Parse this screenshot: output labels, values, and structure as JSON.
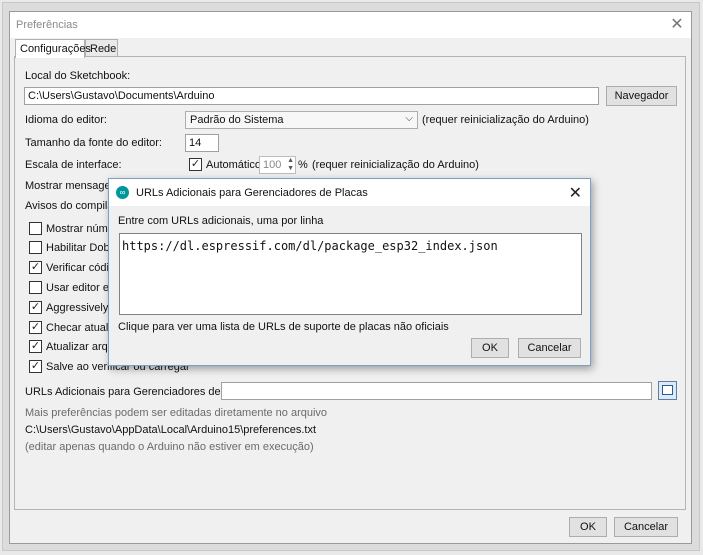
{
  "window": {
    "title": "Preferências",
    "close_glyph": "✕"
  },
  "tabs": [
    {
      "label": "Configurações"
    },
    {
      "label": "Rede"
    }
  ],
  "sketchbook": {
    "label": "Local do Sketchbook:",
    "path": "C:\\Users\\Gustavo\\Documents\\Arduino",
    "browse_button": "Navegador"
  },
  "language": {
    "label": "Idioma do editor:",
    "selected": "Padrão do Sistema",
    "note": "(requer reinicialização do Arduino)"
  },
  "font_size": {
    "label": "Tamanho da fonte do editor:",
    "value": "14"
  },
  "scale": {
    "label": "Escala de interface:",
    "auto_label": "Automático",
    "value": "100",
    "unit": "%",
    "note": "(requer reinicialização do Arduino)"
  },
  "show_messages": {
    "label": "Mostrar mensagens"
  },
  "compiler_warnings": {
    "label": "Avisos do compilador"
  },
  "checkboxes": [
    {
      "label": "Mostrar números",
      "checked": false
    },
    {
      "label": "Habilitar Dobram",
      "checked": false
    },
    {
      "label": "Verificar código",
      "checked": true
    },
    {
      "label": "Usar editor exte",
      "checked": false
    },
    {
      "label": "Aggressively cac",
      "checked": true
    },
    {
      "label": "Checar atualizaç",
      "checked": true
    },
    {
      "label": "Atualizar arquivo",
      "checked": true
    },
    {
      "label": "Salve ao verificar ou carregar",
      "checked": true
    }
  ],
  "board_urls": {
    "label": "URLs Adicionais para Gerenciadores de Placas:",
    "value": ""
  },
  "more_prefs": {
    "line1": "Mais preferências podem ser editadas diretamente no arquivo",
    "path": "C:\\Users\\Gustavo\\AppData\\Local\\Arduino15\\preferences.txt",
    "line3": "(editar apenas quando o Arduino não estiver em execução)"
  },
  "footer": {
    "ok": "OK",
    "cancel": "Cancelar"
  },
  "dialog": {
    "title": "URLs Adicionais para Gerenciadores de Placas",
    "logo_glyph": "∞",
    "close_glyph": "✕",
    "instruction": "Entre com URLs adicionais, uma por linha",
    "urls_text": "https://dl.espressif.com/dl/package_esp32_index.json",
    "help_link": "Clique para ver uma lista de URLs de suporte de placas não oficiais",
    "ok": "OK",
    "cancel": "Cancelar"
  }
}
